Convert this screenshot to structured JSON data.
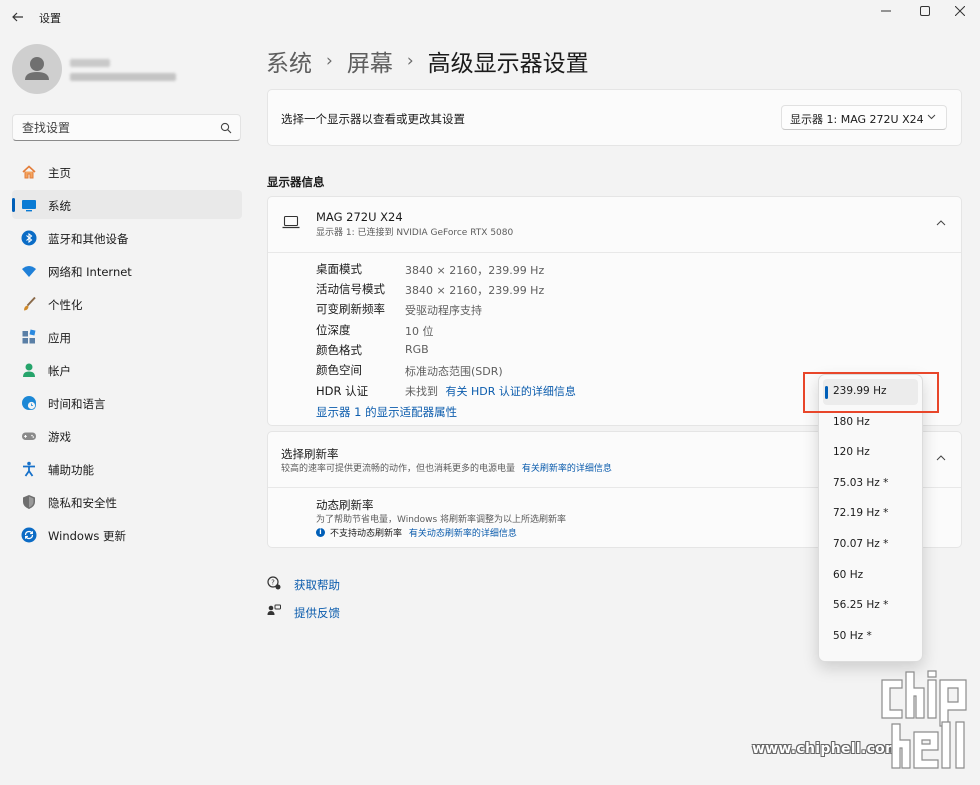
{
  "window": {
    "title": "设置",
    "controls": [
      "minimize",
      "maximize",
      "close"
    ]
  },
  "user": {
    "avatar_icon": "user-avatar-icon"
  },
  "search": {
    "placeholder": "查找设置",
    "icon": "search-icon"
  },
  "sidebar": {
    "items": [
      {
        "label": "主页",
        "icon": "home-icon",
        "icon_color": "#e37d3a"
      },
      {
        "label": "系统",
        "icon": "system-monitor-icon",
        "icon_color": "#0a7bd4",
        "selected": true
      },
      {
        "label": "蓝牙和其他设备",
        "icon": "bluetooth-icon",
        "icon_color": "#0a6cc6"
      },
      {
        "label": "网络和 Internet",
        "icon": "wifi-icon",
        "icon_color": "#1f80d8"
      },
      {
        "label": "个性化",
        "icon": "paintbrush-icon",
        "icon_color": "#d08a2a"
      },
      {
        "label": "应用",
        "icon": "apps-icon",
        "icon_color": "#5a7fa6"
      },
      {
        "label": "帐户",
        "icon": "account-icon",
        "icon_color": "#26a46b"
      },
      {
        "label": "时间和语言",
        "icon": "globe-clock-icon",
        "icon_color": "#1c88d6"
      },
      {
        "label": "游戏",
        "icon": "gamepad-icon",
        "icon_color": "#7c7c7c"
      },
      {
        "label": "辅助功能",
        "icon": "accessibility-icon",
        "icon_color": "#1670c9"
      },
      {
        "label": "隐私和安全性",
        "icon": "shield-icon",
        "icon_color": "#6e6e6e"
      },
      {
        "label": "Windows 更新",
        "icon": "windows-update-icon",
        "icon_color": "#0b6bc5"
      }
    ]
  },
  "breadcrumb": {
    "items": [
      "系统",
      "屏幕"
    ],
    "current": "高级显示器设置"
  },
  "monitor_select": {
    "label": "选择一个显示器以查看或更改其设置",
    "value": "显示器 1: MAG 272U X24"
  },
  "display_info": {
    "section_title": "显示器信息",
    "monitor_name": "MAG 272U X24",
    "monitor_sub": "显示器 1: 已连接到 NVIDIA GeForce RTX 5080",
    "rows": [
      {
        "label": "桌面模式",
        "value": "3840 × 2160，239.99 Hz"
      },
      {
        "label": "活动信号模式",
        "value": "3840 × 2160，239.99 Hz"
      },
      {
        "label": "可变刷新频率",
        "value": "受驱动程序支持"
      },
      {
        "label": "位深度",
        "value": "10 位"
      },
      {
        "label": "颜色格式",
        "value": "RGB"
      },
      {
        "label": "颜色空间",
        "value": "标准动态范围(SDR)"
      },
      {
        "label": "HDR 认证",
        "value": "未找到",
        "link": "有关 HDR 认证的详细信息"
      }
    ],
    "adapter_link": "显示器 1 的显示适配器属性"
  },
  "refresh": {
    "title": "选择刷新率",
    "desc": "较高的速率可提供更流畅的动作，但也消耗更多的电源电量",
    "desc_link": "有关刷新率的详细信息",
    "dynamic_title": "动态刷新率",
    "dynamic_desc": "为了帮助节省电量，Windows 将刷新率调整为以上所选刷新率",
    "dynamic_note": "不支持动态刷新率",
    "dynamic_link": "有关动态刷新率的详细信息",
    "options": [
      "239.99 Hz",
      "180 Hz",
      "120 Hz",
      "75.03 Hz *",
      "72.19 Hz *",
      "70.07 Hz *",
      "60 Hz",
      "56.25 Hz *",
      "50 Hz *"
    ],
    "selected": "239.99 Hz"
  },
  "footer": {
    "help": "获取帮助",
    "feedback": "提供反馈"
  },
  "watermark": {
    "url": "www.chiphell.com",
    "logo_text": "chip hell"
  },
  "colors": {
    "accent": "#005fb8",
    "link": "#0b5cad",
    "highlight_box": "#e8462a"
  }
}
